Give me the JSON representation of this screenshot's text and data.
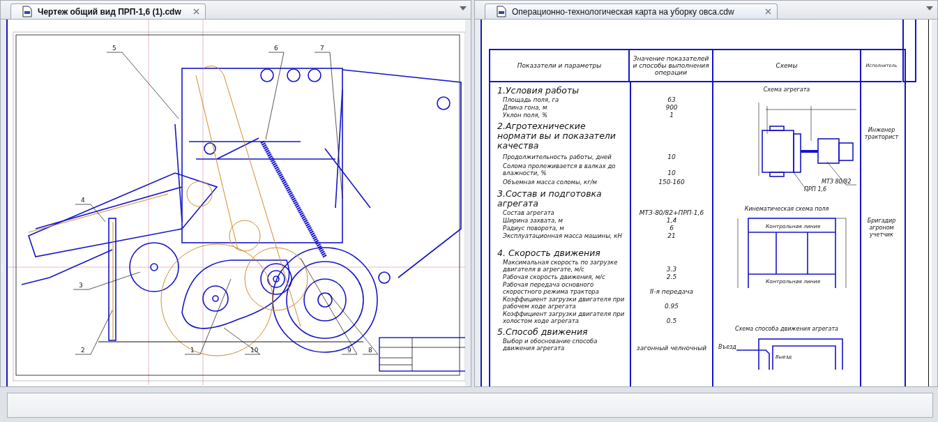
{
  "documents": [
    {
      "title": "Чертеж общий вид ПРП-1,6 (1).cdw",
      "active": true,
      "kind": "assembly",
      "callouts": [
        "5",
        "6",
        "7",
        "4",
        "3",
        "2",
        "1",
        "10",
        "9",
        "8"
      ]
    },
    {
      "title": "Операционно-технологическая карта на уборку овса.cdw",
      "active": false,
      "kind": "card",
      "table": {
        "columns": [
          "Показатели и параметры",
          "Значение показателей и способы выполнения операции",
          "Схемы",
          "Исполнитель"
        ],
        "sections": [
          {
            "heading": "1.Условия работы",
            "rows": [
              {
                "parameter": "Площадь поля, га",
                "value": "63"
              },
              {
                "parameter": "Длина гона, м",
                "value": "900"
              },
              {
                "parameter": "Уклон поля, %",
                "value": "1"
              }
            ]
          },
          {
            "heading": "2.Агротехнические нормати вы и показатели качества",
            "rows": [
              {
                "parameter": "Продолжительность работы, дней",
                "value": "10"
              },
              {
                "parameter": "Солома пролеживается в валках до влажности, %",
                "value": "10"
              },
              {
                "parameter": "Объемная масса соломы, кг/м",
                "value": "150-160"
              }
            ]
          },
          {
            "heading": "3.Состав и подготовка агрегата",
            "rows": [
              {
                "parameter": "Состав агрегата",
                "value": "МТЗ-80/82+ПРП-1,6"
              },
              {
                "parameter": "Ширина захвата, м",
                "value": "1,4"
              },
              {
                "parameter": "Радиус поворота, м",
                "value": "6"
              },
              {
                "parameter": "Эксплуатационная масса машины, кН",
                "value": "21"
              }
            ]
          },
          {
            "heading": "4. Скорость движения",
            "rows": [
              {
                "parameter": "Максимальная скорость по загрузке двигателя в агрегате, м/с",
                "value": "3.3"
              },
              {
                "parameter": "Рабочая скорость движения, м/с",
                "value": "2.5"
              },
              {
                "parameter": "Рабочая передача основного скоростного режима трактора",
                "value": "II-я передача"
              },
              {
                "parameter": "Коэффициент загрузки двигателя при рабочем ходе агрегата",
                "value": "0.95"
              },
              {
                "parameter": "Коэффициент загрузки двигателя при холостом ходе агрегата",
                "value": "0.5"
              }
            ]
          },
          {
            "heading": "5.Способ движения",
            "rows": [
              {
                "parameter": "Выбор и обоснование способа движения агрегата",
                "value": "загонный челночный"
              }
            ]
          }
        ],
        "schemes": [
          {
            "kind": "unit",
            "title": "Схема агрегата",
            "labels": [
              "МТЗ 80/82",
              "ПРП 1,6"
            ]
          },
          {
            "kind": "field",
            "title": "Кинематическая схема поля",
            "labels": [
              "Контрольная линия",
              "Контрольная линия"
            ]
          },
          {
            "kind": "route",
            "title": "Схема способа движения агрегата",
            "labels": [
              "Въезд",
              "Выезд"
            ]
          }
        ],
        "executors": [
          "Инженер тракторист",
          "Бригадир агроном учетчик"
        ]
      }
    }
  ]
}
